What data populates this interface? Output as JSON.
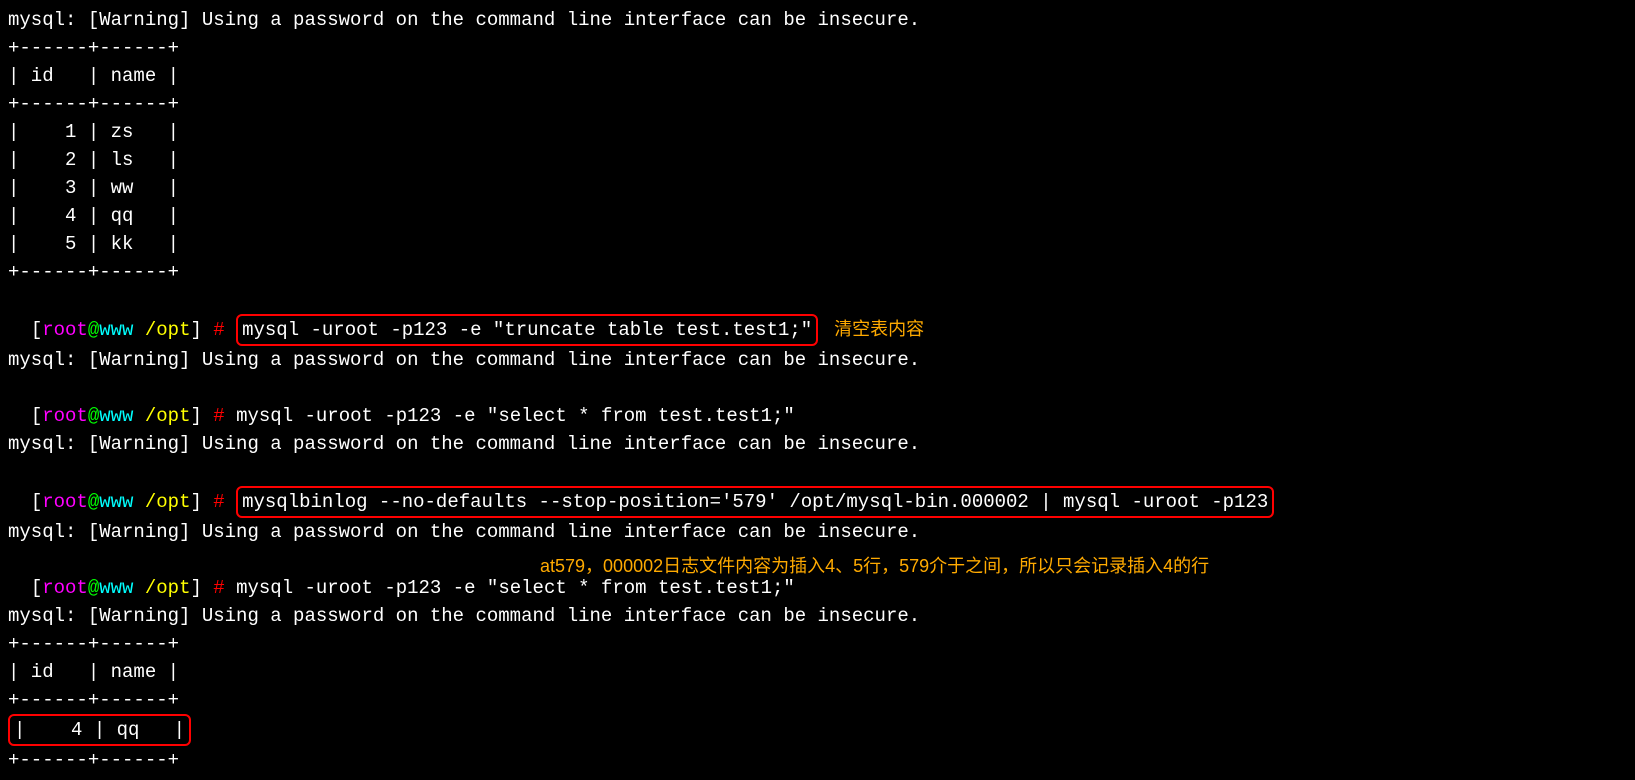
{
  "warnings": {
    "pw_warning": "mysql: [Warning] Using a password on the command line interface can be insecure."
  },
  "prompt": {
    "lb": "[",
    "user": "root",
    "at": "@",
    "host": "www",
    "sp": " ",
    "path": "/opt",
    "rb": "]",
    "hash": " #",
    "gap": " "
  },
  "cmds": {
    "truncate": "mysql -uroot -p123 -e \"truncate table test.test1;\"",
    "select1": "mysql -uroot -p123 -e \"select * from test.test1;\"",
    "binlog": "mysqlbinlog --no-defaults --stop-position='579' /opt/mysql-bin.000002 | mysql -uroot -p123",
    "select2": "mysql -uroot -p123 -e \"select * from test.test1;\""
  },
  "table1": {
    "border": "+------+------+",
    "header": "| id   | name |",
    "row1": "|    1 | zs   |",
    "row2": "|    2 | ls   |",
    "row3": "|    3 | ww   |",
    "row4": "|    4 | qq   |",
    "row5": "|    5 | kk   |"
  },
  "table2": {
    "border": "+------+------+",
    "header": "| id   | name |",
    "row4": "|    4 | qq   |"
  },
  "annotations": {
    "a1": "清空表内容",
    "a2": "at579，000002日志文件内容为插入4、5行，579介于之间，所以只会记录插入4的行"
  }
}
